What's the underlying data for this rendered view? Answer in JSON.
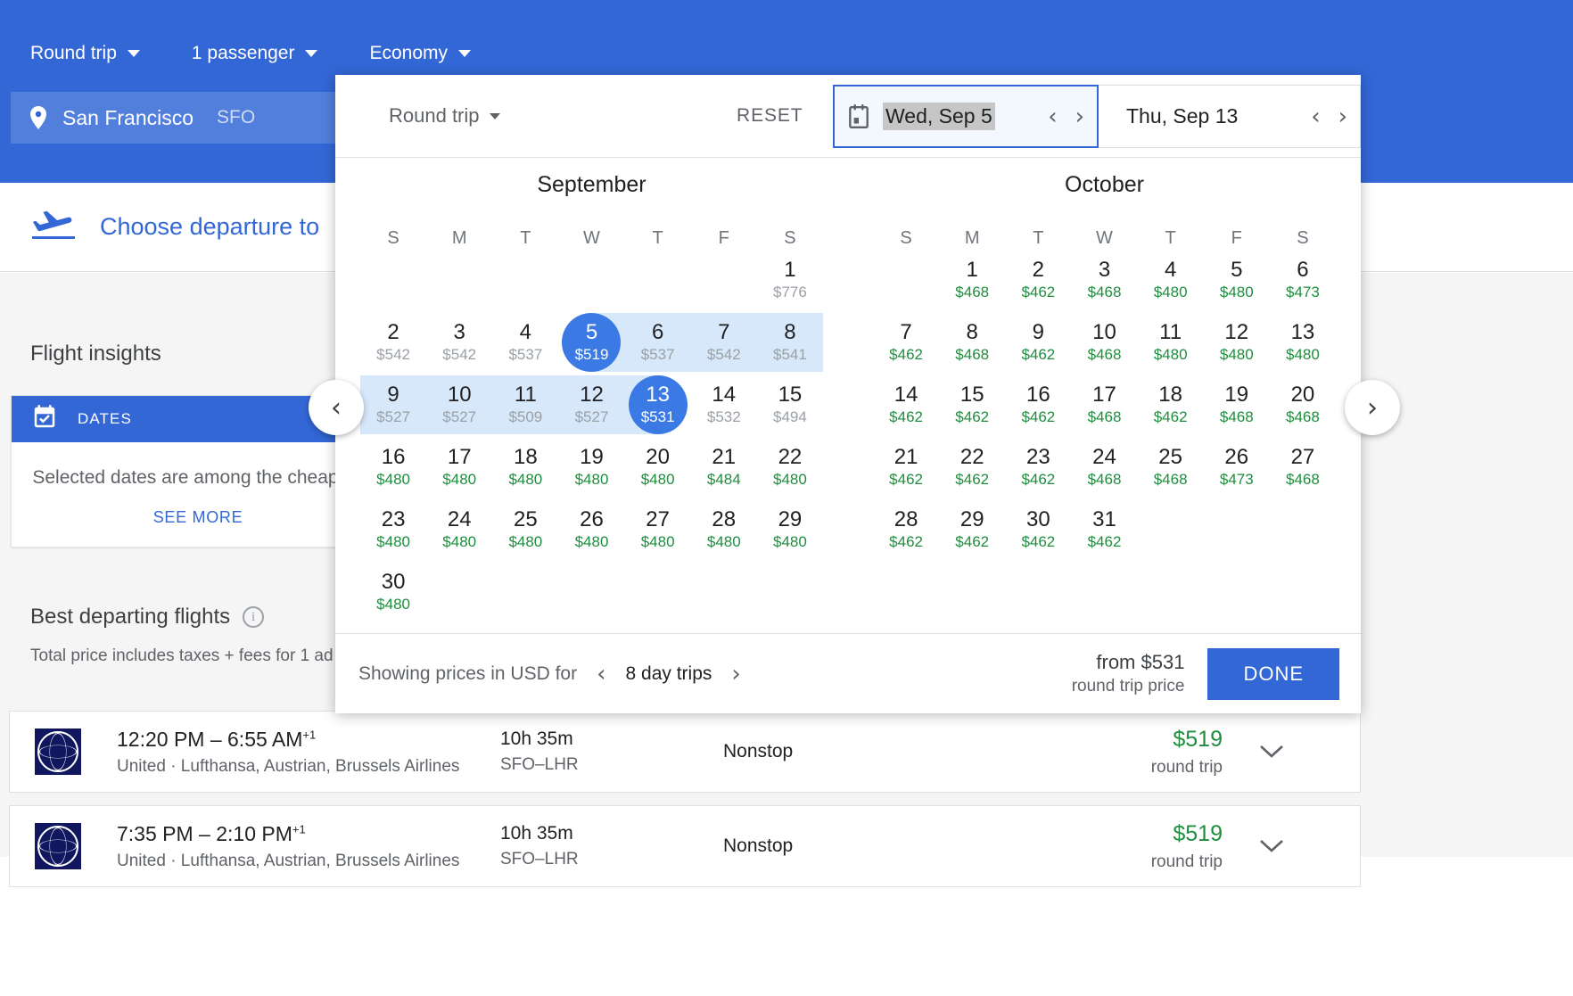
{
  "header": {
    "controls": [
      {
        "label": "Round trip",
        "icon": "chevron-down-icon"
      },
      {
        "label": "1 passenger",
        "icon": "chevron-down-icon"
      },
      {
        "label": "Economy",
        "icon": "chevron-down-icon"
      }
    ],
    "origin": {
      "city": "San Francisco",
      "code": "SFO",
      "icon": "location-pin-icon"
    },
    "accent": "#3367d6"
  },
  "page": {
    "choose_departure": "Choose departure to",
    "insights_title": "Flight insights",
    "dates_card": {
      "tab_label": "DATES",
      "body": "Selected dates are among the cheapest",
      "link": "SEE MORE"
    },
    "best_title": "Best departing flights",
    "best_sub": "Total price includes taxes + fees for 1 ad",
    "flights": [
      {
        "times": "12:20 PM – 6:55 AM",
        "plus": "+1",
        "airlines": "United · Lufthansa, Austrian, Brussels Airlines",
        "duration": "10h 35m",
        "route": "SFO–LHR",
        "stops": "Nonstop",
        "price": "$519",
        "price_note": "round trip"
      },
      {
        "times": "7:35 PM – 2:10 PM",
        "plus": "+1",
        "airlines": "United · Lufthansa, Austrian, Brussels Airlines",
        "duration": "10h 35m",
        "route": "SFO–LHR",
        "stops": "Nonstop",
        "price": "$519",
        "price_note": "round trip"
      }
    ]
  },
  "calendar": {
    "trip_type": "Round trip",
    "reset": "RESET",
    "depart": {
      "value": "Wed, Sep 5",
      "selected": true
    },
    "return": {
      "value": "Thu, Sep 13",
      "selected": false
    },
    "dow": [
      "S",
      "M",
      "T",
      "W",
      "T",
      "F",
      "S"
    ],
    "footer": {
      "showing_prices": "Showing prices in USD for",
      "trip_length": "8 day trips",
      "from_price": "from $531",
      "from_note": "round trip price",
      "done": "DONE"
    },
    "prev_month_icon": "chevron-left-icon",
    "next_month_icon": "chevron-right-icon",
    "months": [
      {
        "name": "September",
        "lead_blanks": 6,
        "days": [
          {
            "d": 1,
            "price": "$776",
            "state": "dim"
          },
          {
            "d": 2,
            "price": "$542",
            "state": "dim"
          },
          {
            "d": 3,
            "price": "$542",
            "state": "dim"
          },
          {
            "d": 4,
            "price": "$537",
            "state": "dim"
          },
          {
            "d": 5,
            "price": "$519",
            "state": "selected-start"
          },
          {
            "d": 6,
            "price": "$537",
            "state": "in-range"
          },
          {
            "d": 7,
            "price": "$542",
            "state": "in-range"
          },
          {
            "d": 8,
            "price": "$541",
            "state": "in-range"
          },
          {
            "d": 9,
            "price": "$527",
            "state": "in-range"
          },
          {
            "d": 10,
            "price": "$527",
            "state": "in-range"
          },
          {
            "d": 11,
            "price": "$509",
            "state": "in-range"
          },
          {
            "d": 12,
            "price": "$527",
            "state": "in-range"
          },
          {
            "d": 13,
            "price": "$531",
            "state": "selected-end"
          },
          {
            "d": 14,
            "price": "$532",
            "state": "dim"
          },
          {
            "d": 15,
            "price": "$494",
            "state": "dim"
          },
          {
            "d": 16,
            "price": "$480",
            "state": "normal"
          },
          {
            "d": 17,
            "price": "$480",
            "state": "normal"
          },
          {
            "d": 18,
            "price": "$480",
            "state": "normal"
          },
          {
            "d": 19,
            "price": "$480",
            "state": "normal"
          },
          {
            "d": 20,
            "price": "$480",
            "state": "normal"
          },
          {
            "d": 21,
            "price": "$484",
            "state": "normal"
          },
          {
            "d": 22,
            "price": "$480",
            "state": "normal"
          },
          {
            "d": 23,
            "price": "$480",
            "state": "normal"
          },
          {
            "d": 24,
            "price": "$480",
            "state": "normal"
          },
          {
            "d": 25,
            "price": "$480",
            "state": "normal"
          },
          {
            "d": 26,
            "price": "$480",
            "state": "normal"
          },
          {
            "d": 27,
            "price": "$480",
            "state": "normal"
          },
          {
            "d": 28,
            "price": "$480",
            "state": "normal"
          },
          {
            "d": 29,
            "price": "$480",
            "state": "normal"
          },
          {
            "d": 30,
            "price": "$480",
            "state": "normal"
          }
        ]
      },
      {
        "name": "October",
        "lead_blanks": 1,
        "days": [
          {
            "d": 1,
            "price": "$468",
            "state": "normal"
          },
          {
            "d": 2,
            "price": "$462",
            "state": "normal"
          },
          {
            "d": 3,
            "price": "$468",
            "state": "normal"
          },
          {
            "d": 4,
            "price": "$480",
            "state": "normal"
          },
          {
            "d": 5,
            "price": "$480",
            "state": "normal"
          },
          {
            "d": 6,
            "price": "$473",
            "state": "normal"
          },
          {
            "d": 7,
            "price": "$462",
            "state": "normal"
          },
          {
            "d": 8,
            "price": "$468",
            "state": "normal"
          },
          {
            "d": 9,
            "price": "$462",
            "state": "normal"
          },
          {
            "d": 10,
            "price": "$468",
            "state": "normal"
          },
          {
            "d": 11,
            "price": "$480",
            "state": "normal"
          },
          {
            "d": 12,
            "price": "$480",
            "state": "normal"
          },
          {
            "d": 13,
            "price": "$480",
            "state": "normal"
          },
          {
            "d": 14,
            "price": "$462",
            "state": "normal"
          },
          {
            "d": 15,
            "price": "$462",
            "state": "normal"
          },
          {
            "d": 16,
            "price": "$462",
            "state": "normal"
          },
          {
            "d": 17,
            "price": "$468",
            "state": "normal"
          },
          {
            "d": 18,
            "price": "$462",
            "state": "normal"
          },
          {
            "d": 19,
            "price": "$468",
            "state": "normal"
          },
          {
            "d": 20,
            "price": "$468",
            "state": "normal"
          },
          {
            "d": 21,
            "price": "$462",
            "state": "normal"
          },
          {
            "d": 22,
            "price": "$462",
            "state": "normal"
          },
          {
            "d": 23,
            "price": "$462",
            "state": "normal"
          },
          {
            "d": 24,
            "price": "$468",
            "state": "normal"
          },
          {
            "d": 25,
            "price": "$468",
            "state": "normal"
          },
          {
            "d": 26,
            "price": "$473",
            "state": "normal"
          },
          {
            "d": 27,
            "price": "$468",
            "state": "normal"
          },
          {
            "d": 28,
            "price": "$462",
            "state": "normal"
          },
          {
            "d": 29,
            "price": "$462",
            "state": "normal"
          },
          {
            "d": 30,
            "price": "$462",
            "state": "normal"
          },
          {
            "d": 31,
            "price": "$462",
            "state": "normal"
          }
        ]
      }
    ]
  }
}
